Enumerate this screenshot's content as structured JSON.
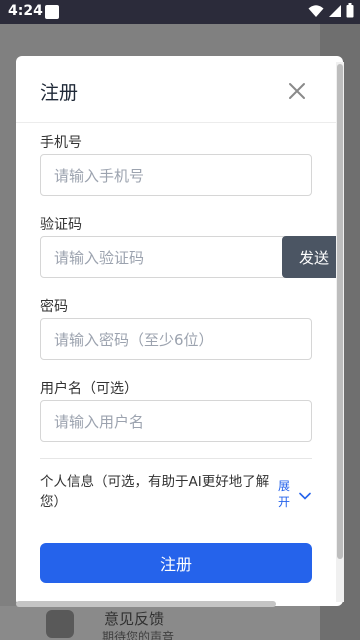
{
  "status_bar": {
    "time": "4:24"
  },
  "background": {
    "feedback_title": "意见反馈",
    "feedback_subtitle": "期待您的声音"
  },
  "dialog": {
    "title": "注册",
    "phone": {
      "label": "手机号",
      "placeholder": "请输入手机号"
    },
    "code": {
      "label": "验证码",
      "placeholder": "请输入验证码",
      "send_button": "发送"
    },
    "password": {
      "label": "密码",
      "placeholder": "请输入密码（至少6位）"
    },
    "username": {
      "label": "用户名（可选）",
      "placeholder": "请输入用户名"
    },
    "personal_info": {
      "text": "个人信息（可选，有助于AI更好地了解您）",
      "expand_label": "展开"
    },
    "submit_label": "注册"
  },
  "colors": {
    "primary": "#2563eb",
    "send_button": "#4b5563"
  }
}
